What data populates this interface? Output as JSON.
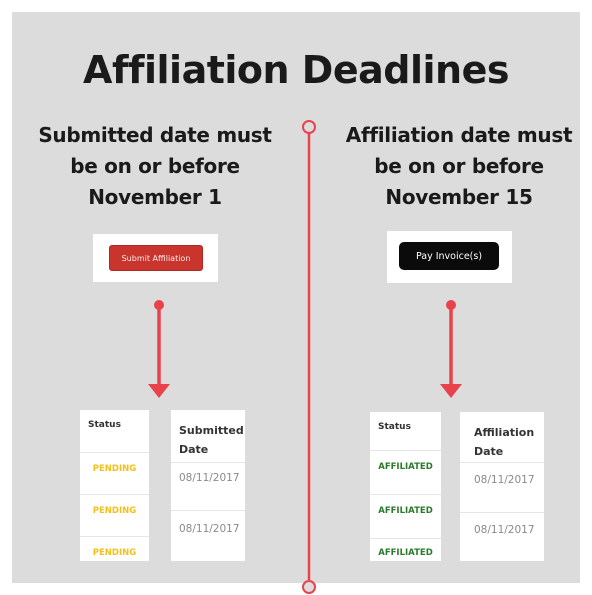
{
  "title": "Affiliation Deadlines",
  "left": {
    "heading_lines": [
      "Submitted date must",
      "be on or before",
      "November 1"
    ],
    "button_label": "Submit Affiliation",
    "table": {
      "status_header": "Status",
      "date_header": "Submitted Date",
      "statuses": [
        "PENDING",
        "PENDING",
        "PENDING"
      ],
      "dates": [
        "08/11/2017",
        "08/11/2017"
      ]
    }
  },
  "right": {
    "heading_lines": [
      "Affiliation date must",
      "be on or before",
      "November 15"
    ],
    "button_label": "Pay Invoice(s)",
    "table": {
      "status_header": "Status",
      "date_header": "Affiliation Date",
      "statuses": [
        "AFFILIATED",
        "AFFILIATED",
        "AFFILIATED"
      ],
      "dates": [
        "08/11/2017",
        "08/11/2017"
      ]
    }
  },
  "colors": {
    "background": "#dcdcdc",
    "accent_red": "#e8424c",
    "pending": "#f2c018",
    "affiliated": "#2a7a2a",
    "submit_button": "#c9342c",
    "pay_button": "#0b0b0b"
  }
}
